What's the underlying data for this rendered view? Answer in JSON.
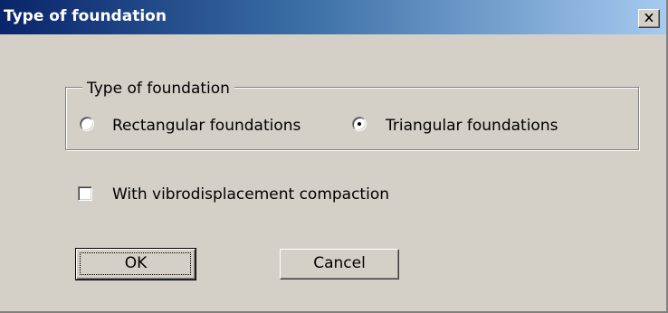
{
  "dialog": {
    "title": "Type of foundation",
    "close_icon": "close-icon"
  },
  "foundation_group": {
    "legend": "Type of foundation",
    "options": [
      {
        "label": "Rectangular foundations",
        "selected": false
      },
      {
        "label": "Triangular foundations",
        "selected": true
      }
    ]
  },
  "vibro_checkbox": {
    "label": "With vibrodisplacement compaction",
    "checked": false
  },
  "buttons": {
    "ok_label": "OK",
    "cancel_label": "Cancel"
  },
  "colors": {
    "face": "#d4d0c8",
    "title_gradient_start": "#0a246a",
    "title_gradient_end": "#a6caf0"
  }
}
